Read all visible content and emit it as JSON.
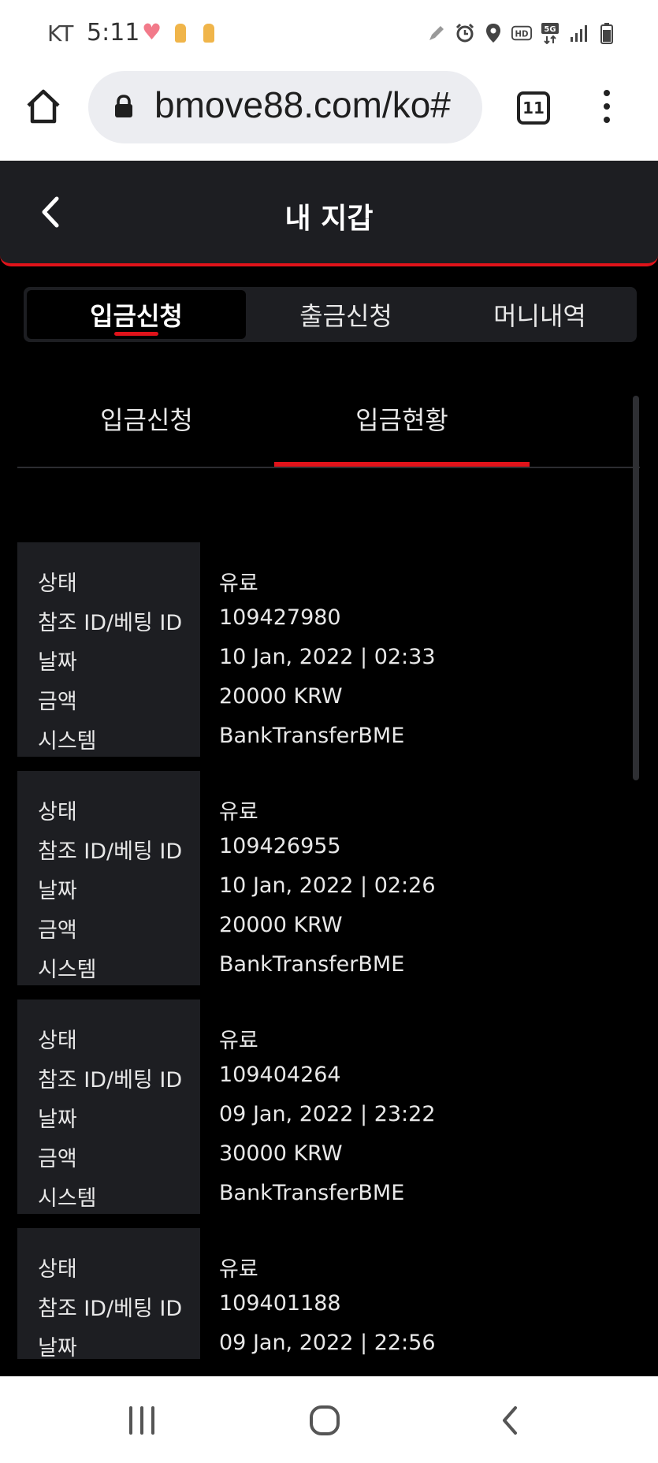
{
  "status_bar": {
    "carrier": "KT",
    "time": "5:11"
  },
  "browser": {
    "url": "bmove88.com/ko#",
    "tab_count": "11"
  },
  "header": {
    "title": "내 지갑"
  },
  "main_tabs": [
    {
      "label": "입금신청",
      "active": true
    },
    {
      "label": "출금신청",
      "active": false
    },
    {
      "label": "머니내역",
      "active": false
    }
  ],
  "sub_tabs": [
    {
      "label": "입금신청",
      "active": false
    },
    {
      "label": "입금현황",
      "active": true
    }
  ],
  "field_labels": {
    "status": "상태",
    "ref_id": "참조 ID/베팅 ID",
    "date": "날짜",
    "amount": "금액",
    "system": "시스템"
  },
  "records": [
    {
      "status": "유료",
      "ref_id": "109427980",
      "date": "10 Jan, 2022 | 02:33",
      "amount": "20000 KRW",
      "system": "BankTransferBME"
    },
    {
      "status": "유료",
      "ref_id": "109426955",
      "date": "10 Jan, 2022 | 02:26",
      "amount": "20000 KRW",
      "system": "BankTransferBME"
    },
    {
      "status": "유료",
      "ref_id": "109404264",
      "date": "09 Jan, 2022 | 23:22",
      "amount": "30000 KRW",
      "system": "BankTransferBME"
    },
    {
      "status": "유료",
      "ref_id": "109401188",
      "date": "09 Jan, 2022 | 22:56"
    }
  ],
  "colors": {
    "accent": "#e0131a",
    "panel": "#1d1e22",
    "background": "#000000"
  }
}
